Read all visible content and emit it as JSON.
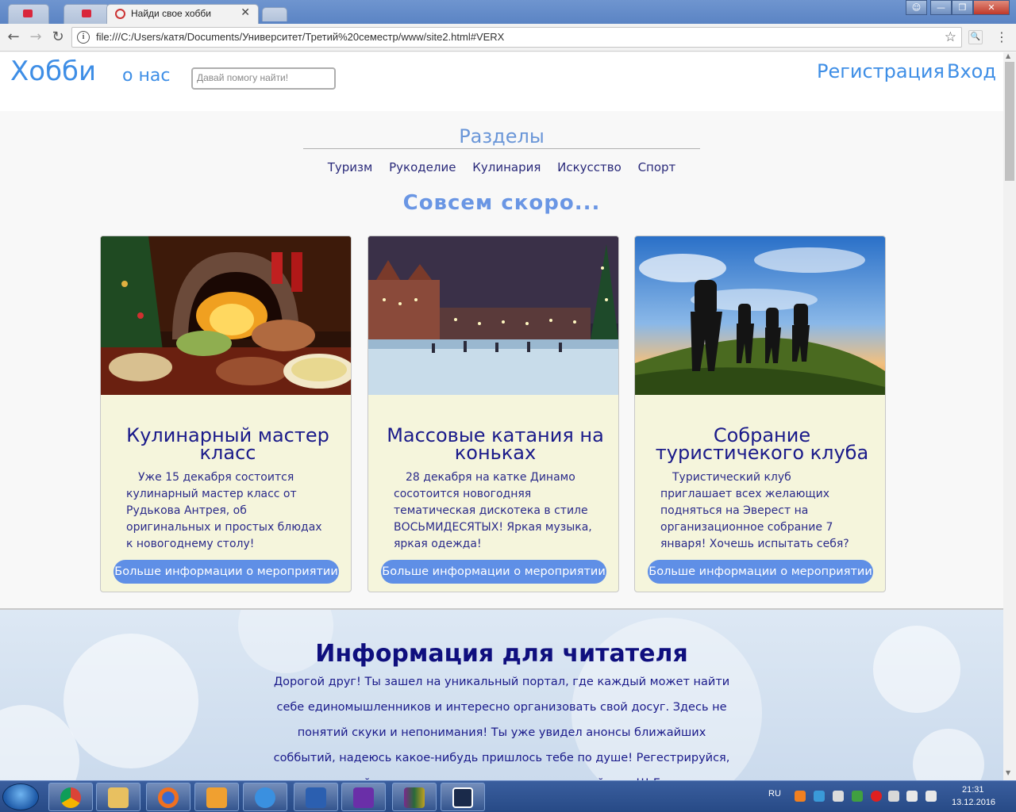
{
  "browser": {
    "active_tab_title": "Найди свое хобби",
    "address": "file:///C:/Users/катя/Documents/Университет/Третий%20семестр/www/site2.html#VERX"
  },
  "header": {
    "logo": "Хобби",
    "about_link": "о нас",
    "search_placeholder": "Давай помогу найти!",
    "register_link": "Регистрация",
    "login_link": "Вход"
  },
  "sections": {
    "title": "Разделы",
    "items": [
      "Туризм",
      "Рукоделие",
      "Кулинария",
      "Искусство",
      "Спорт"
    ]
  },
  "soon_heading": "Совсем скоро...",
  "cards": [
    {
      "title": "Кулинарный мастер класс",
      "text": "Уже 15 декабря состоится кулинарный мастер класс от Рудькова Антрея, об оригинальных и простых блюдах к новогоднему столу!",
      "button": "Больше информации о мероприятии"
    },
    {
      "title": "Массовые катания на коньках",
      "text": "28 декабря на катке Динамо сосотоится новогодняя тематическая дискотека в стиле ВОСЬМИДЕСЯТЫХ! Яркая музыка, яркая одежда!",
      "button": "Больше информации о мероприятии"
    },
    {
      "title": "Собрание туристичекого клуба",
      "text": "Туристический клуб приглашает всех желающих подняться на Эверест на организационное собрание 7 января! Хочешь испытать себя?",
      "button": "Больше информации о мероприятии"
    }
  ],
  "info": {
    "title": "Информация для читателя",
    "text": "Дорогой друг! Ты зашел на уникальный портал, где каждый может найти себе единомышленников и интересно организовать свой досуг. Здесь не понятий скуки и непонимания! Ты уже увидел анонсы ближайших соббытий, надеюсь какое-нибудь пришлось тебе по душе! Регестрируйся, заводи друзей, приходи на мероприятия, предлагай свои!!! Главное не грусти перед монитором! Свои"
  },
  "taskbar": {
    "language": "RU",
    "time": "21:31",
    "date": "13.12.2016"
  }
}
